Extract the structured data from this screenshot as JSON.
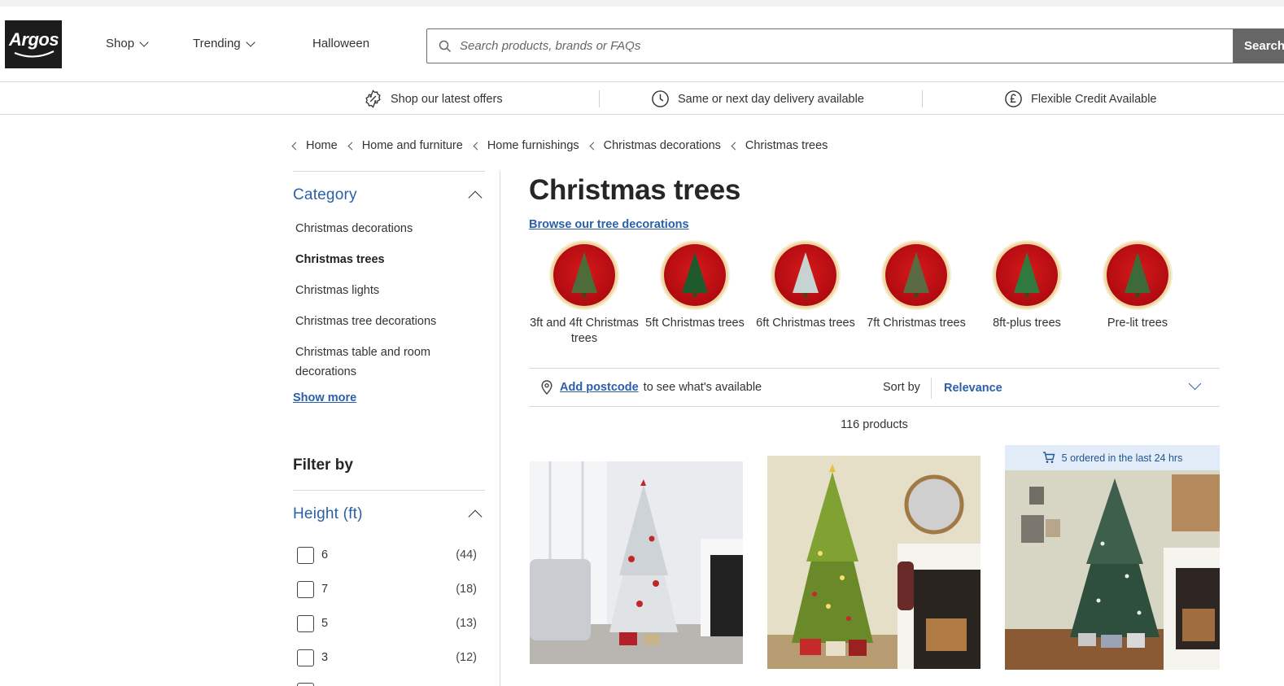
{
  "header": {
    "logo_text": "Argos",
    "nav": [
      {
        "label": "Shop"
      },
      {
        "label": "Trending"
      },
      {
        "label": "Halloween"
      }
    ],
    "search": {
      "placeholder": "Search products, brands or FAQs",
      "button_label": "Search"
    }
  },
  "benefits": [
    {
      "label": "Shop our latest offers",
      "icon": "offer-badge-icon"
    },
    {
      "label": "Same or next day delivery available",
      "icon": "clock-icon"
    },
    {
      "label": "Flexible Credit Available",
      "icon": "pound-icon"
    }
  ],
  "breadcrumb": [
    "Home",
    "Home and furniture",
    "Home furnishings",
    "Christmas decorations",
    "Christmas trees"
  ],
  "sidebar": {
    "category_title": "Category",
    "categories": [
      {
        "label": "Christmas decorations",
        "active": false
      },
      {
        "label": "Christmas trees",
        "active": true
      },
      {
        "label": "Christmas lights",
        "active": false
      },
      {
        "label": "Christmas tree decorations",
        "active": false
      },
      {
        "label": "Christmas table and room decorations",
        "active": false
      }
    ],
    "show_more": "Show more",
    "filter_by": "Filter by",
    "height_title": "Height (ft)",
    "height_options": [
      {
        "label": "6",
        "count": "(44)"
      },
      {
        "label": "7",
        "count": "(18)"
      },
      {
        "label": "5",
        "count": "(13)"
      },
      {
        "label": "3",
        "count": "(12)"
      }
    ]
  },
  "main": {
    "title": "Christmas trees",
    "browse_link": "Browse our tree decorations",
    "tiles": [
      {
        "label": "3ft and 4ft Christmas trees",
        "tree_color": "#4e6b3a"
      },
      {
        "label": "5ft Christmas trees",
        "tree_color": "#1f5a2c"
      },
      {
        "label": "6ft Christmas trees",
        "tree_color": "#c7d3d0"
      },
      {
        "label": "7ft Christmas trees",
        "tree_color": "#5a6b44"
      },
      {
        "label": "8ft-plus trees",
        "tree_color": "#2f7a3c"
      },
      {
        "label": "Pre-lit trees",
        "tree_color": "#3e6a3a"
      }
    ],
    "postcode_link": "Add postcode",
    "postcode_text": "to see what's available",
    "sort_label": "Sort by",
    "sort_value": "Relevance",
    "product_count": "116 products",
    "badge_text": "5 ordered in the last 24 hrs"
  },
  "colors": {
    "link_blue": "#2b5fa7",
    "search_button": "#666666",
    "badge_bg": "#e1ecf8"
  }
}
